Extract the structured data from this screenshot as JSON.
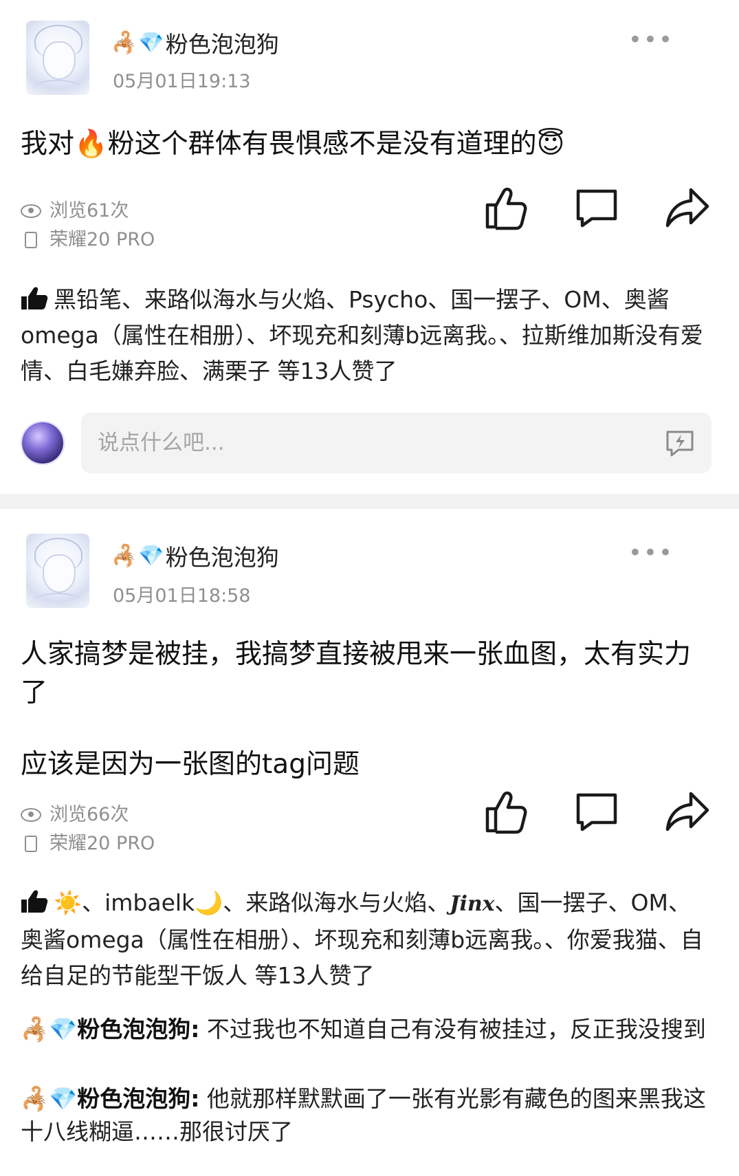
{
  "posts": [
    {
      "author": "粉色泡泡狗",
      "author_badges": [
        "🦂",
        "💎"
      ],
      "time": "05月01日19:13",
      "more_label": "•••",
      "text_before_emoji": "我对",
      "inline_emoji": "🔥",
      "text_after_emoji": "粉这个群体有畏惧感不是没有道理的",
      "trailing_emoji": "😇",
      "views": "浏览61次",
      "device": "荣耀20 PRO",
      "likes_text": "黑铅笔、来路似海水与火焰、Psycho、国一摆子、OM、奥酱omega（属性在相册）、坏现充和刻薄b远离我。、拉斯维加斯没有爱情、白毛嫌弃脸、满栗子 等13人赞了",
      "comment_placeholder": "说点什么吧..."
    },
    {
      "author": "粉色泡泡狗",
      "author_badges": [
        "🦂",
        "💎"
      ],
      "time": "05月01日18:58",
      "more_label": "•••",
      "paragraph1": "人家搞梦是被挂，我搞梦直接被甩来一张血图，太有实力了",
      "paragraph2": "应该是因为一张图的tag问题",
      "views": "浏览66次",
      "device": "荣耀20 PRO",
      "likes_part1": "☀️、imbaelk🌙、来路似海水与火焰、",
      "likes_script_name": "Jinx",
      "likes_part2": "、国一摆子、OM、奥酱omega（属性在相册）、坏现充和刻薄b远离我。、你爱我猫、自给自足的节能型干饭人 等13人赞了",
      "replies": [
        {
          "badges": "🦂💎",
          "author": "粉色泡泡狗:",
          "text": "不过我也不知道自己有没有被挂过，反正我没搜到"
        },
        {
          "badges": "🦂💎",
          "author": "粉色泡泡狗:",
          "text": "他就那样默默画了一张有光影有藏色的图来黑我这十八线糊逼……那很讨厌了"
        }
      ]
    }
  ],
  "icons": {
    "view": "eye-icon",
    "device": "phone-icon",
    "like": "thumbs-up-icon",
    "comment": "comment-bubble-icon",
    "share": "share-arrow-icon",
    "liked_by": "filled-thumbs-up-icon",
    "quick_reply": "lightning-chat-icon"
  },
  "colors": {
    "text_primary": "#111111",
    "text_secondary": "#8f8f8f",
    "input_bg": "#f3f3f3",
    "divider": "#f2f2f2"
  }
}
